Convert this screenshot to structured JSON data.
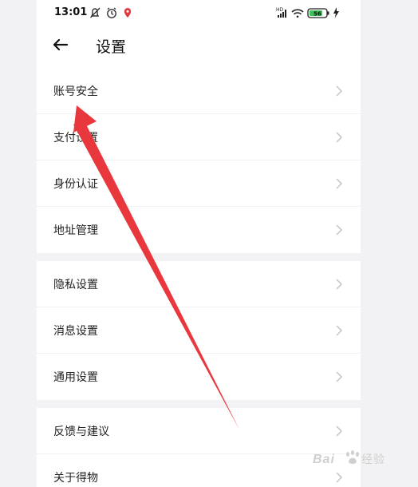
{
  "status_bar": {
    "time": "13:01",
    "left_icons": [
      "mute-notification-icon",
      "alarm-icon",
      "location-pin-icon"
    ],
    "right_icons": [
      "signal-icon",
      "wifi-icon",
      "battery-icon",
      "charging-icon"
    ],
    "signal_label": "HD",
    "battery_level": "56"
  },
  "header": {
    "back_icon": "arrow-left-icon",
    "title": "设置"
  },
  "groups": [
    {
      "items": [
        {
          "label": "账号安全"
        },
        {
          "label": "支付设置"
        },
        {
          "label": "身份认证"
        },
        {
          "label": "地址管理"
        }
      ]
    },
    {
      "items": [
        {
          "label": "隐私设置"
        },
        {
          "label": "消息设置"
        },
        {
          "label": "通用设置"
        }
      ]
    },
    {
      "items": [
        {
          "label": "反馈与建议"
        },
        {
          "label": "关于得物"
        }
      ]
    }
  ],
  "colors": {
    "annotation_arrow": "#e8383d",
    "chevron": "#c4c4c8",
    "background": "#f2f2f4"
  },
  "watermark": {
    "text_a": "Bai",
    "text_b": "经验"
  }
}
